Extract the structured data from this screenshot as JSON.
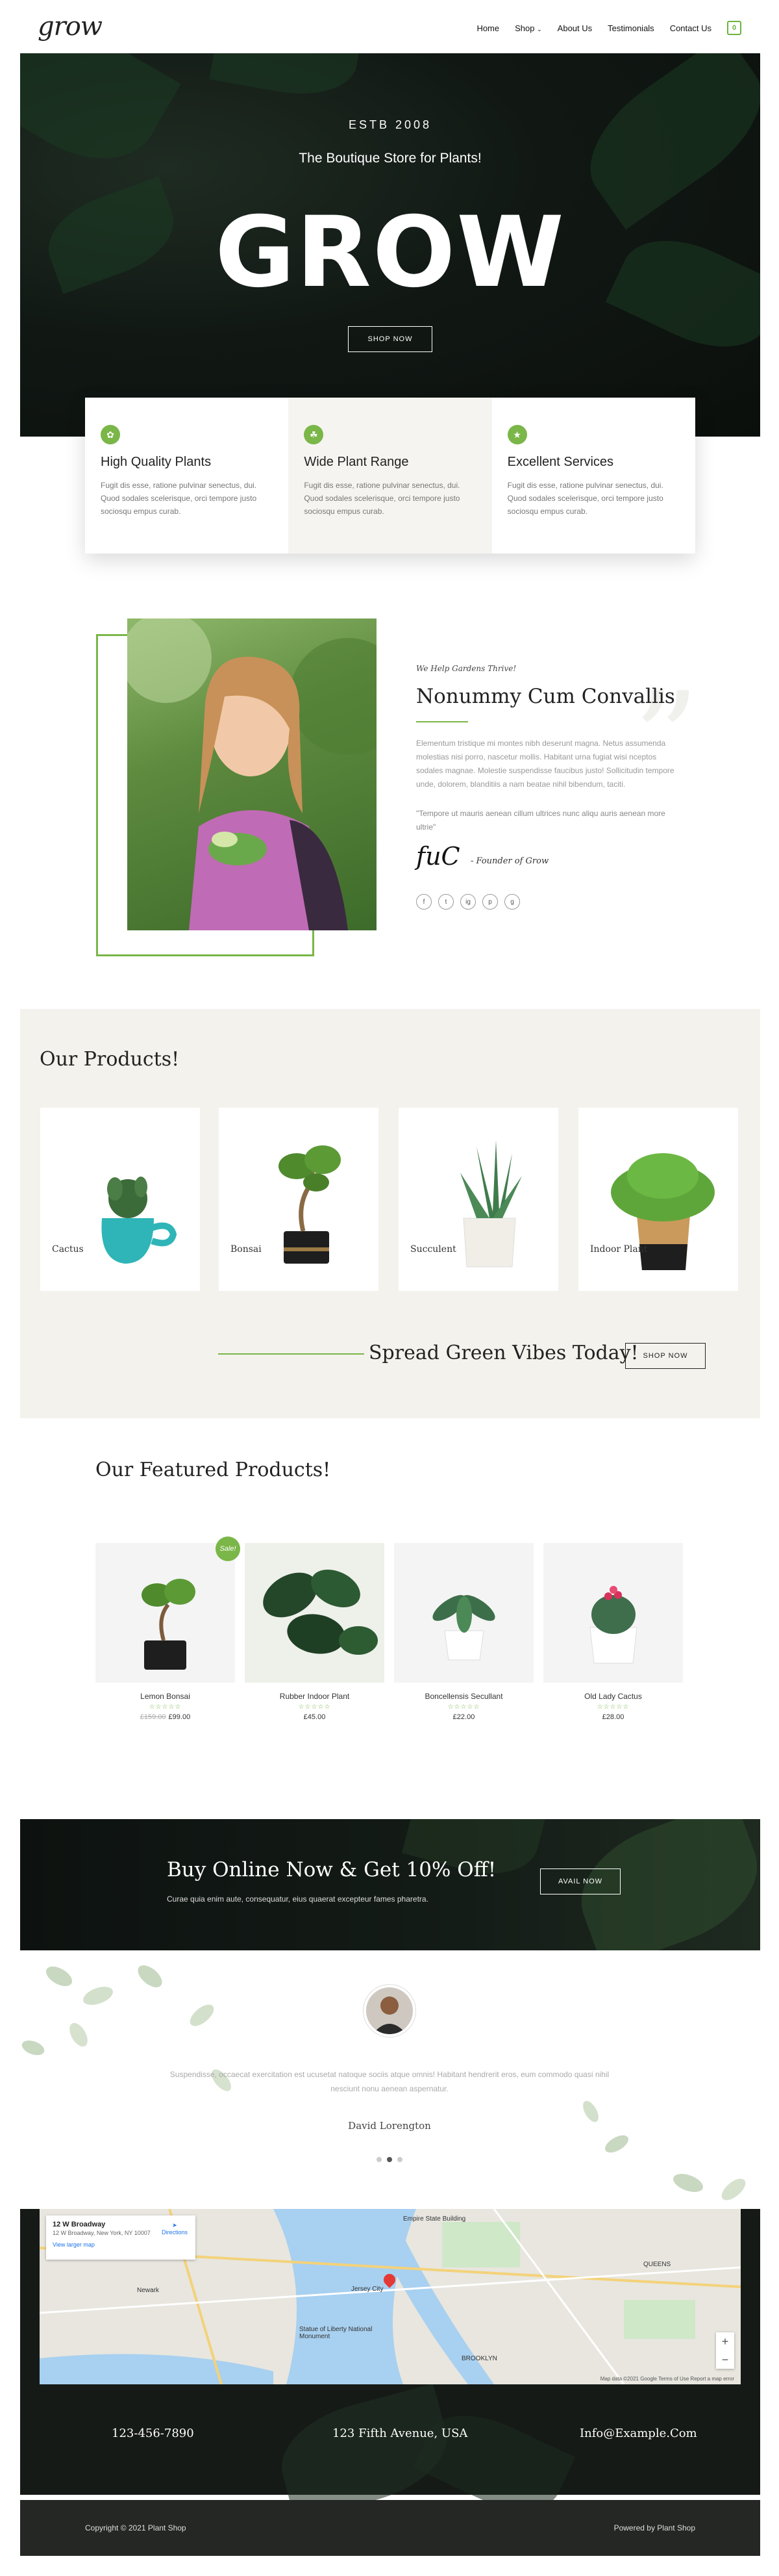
{
  "brand": {
    "logo": "grow"
  },
  "nav": {
    "items": [
      "Home",
      "Shop",
      "About Us",
      "Testimonials",
      "Contact Us"
    ],
    "cart_count": "0"
  },
  "hero": {
    "estb": "ESTB 2008",
    "subtitle": "The Boutique Store for Plants!",
    "title": "GROW",
    "button": "SHOP NOW"
  },
  "features": [
    {
      "title": "High Quality Plants",
      "text": "Fugit dis esse, ratione pulvinar senectus, dui. Quod sodales scelerisque, orci tempore justo sociosqu empus curab.",
      "icon": "leaf-icon"
    },
    {
      "title": "Wide Plant Range",
      "text": "Fugit dis esse, ratione pulvinar senectus, dui. Quod sodales scelerisque, orci tempore justo sociosqu empus curab.",
      "icon": "seedling-icon"
    },
    {
      "title": "Excellent Services",
      "text": "Fugit dis esse, ratione pulvinar senectus, dui. Quod sodales scelerisque, orci tempore justo sociosqu empus curab.",
      "icon": "trophy-icon"
    }
  ],
  "about": {
    "small": "We Help Gardens Thrive!",
    "title": "Nonummy Cum Convallis",
    "text": "Elementum tristique mi montes nibh deserunt magna. Netus assumenda molestias nisi porro, nascetur mollis. Habitant urna fugiat wisi nceptos sodales magnae. Molestie suspendisse faucibus justo! Sollicitudin tempore unde, dolorem, blanditiis a nam beatae nihil bibendum, taciti.",
    "quote": "\"Tempore ut mauris aenean cillum ultrices nunc aliqu auris aenean more ultrie\"",
    "signature": "fuC",
    "founder": "- Founder of Grow",
    "socials": [
      "f",
      "t",
      "ig",
      "p",
      "g"
    ]
  },
  "products": {
    "title": "Our Products!",
    "items": [
      "Cactus",
      "Bonsai",
      "Succulent",
      "Indoor Plant"
    ],
    "cta_title": "Spread Green Vibes Today!",
    "cta_button": "SHOP NOW"
  },
  "featured": {
    "title": "Our Featured Products!",
    "sale_badge": "Sale!",
    "items": [
      {
        "name": "Lemon Bonsai",
        "stars": "☆☆☆☆☆",
        "old_price": "£159.00",
        "price": "£99.00"
      },
      {
        "name": "Rubber Indoor Plant",
        "stars": "☆☆☆☆☆",
        "price": "£45.00"
      },
      {
        "name": "Boncellensis Secullant",
        "stars": "☆☆☆☆☆",
        "price": "£22.00"
      },
      {
        "name": "Old Lady Cactus",
        "stars": "☆☆☆☆☆",
        "price": "£28.00"
      }
    ]
  },
  "offer": {
    "title": "Buy Online Now & Get 10% Off!",
    "text": "Curae quia enim aute, consequatur, eius quaerat excepteur fames pharetra.",
    "button": "AVAIL NOW"
  },
  "testimonial": {
    "text": "Suspendisse, occaecat exercitation est ucusetat natoque sociis atque omnis! Habitant hendrerit eros, eum commodo quasi nihil nesciunt nonu aenean aspernatur.",
    "name": "David Lorengton"
  },
  "map": {
    "place": "12 W Broadway",
    "address": "12 W Broadway, New York, NY 10007",
    "larger_map": "View larger map",
    "directions": "Directions",
    "labels": [
      "Jersey City",
      "BROOKLYN",
      "Empire State Building",
      "QUEENS",
      "Newark",
      "Statue of Liberty National Monument"
    ],
    "footer": "Map data ©2021 Google   Terms of Use   Report a map error"
  },
  "contact": {
    "phone": "123-456-7890",
    "address": "123 Fifth Avenue, USA",
    "email": "Info@Example.Com"
  },
  "footer": {
    "copyright": "Copyright © 2021 Plant Shop",
    "powered": "Powered by Plant Shop"
  }
}
